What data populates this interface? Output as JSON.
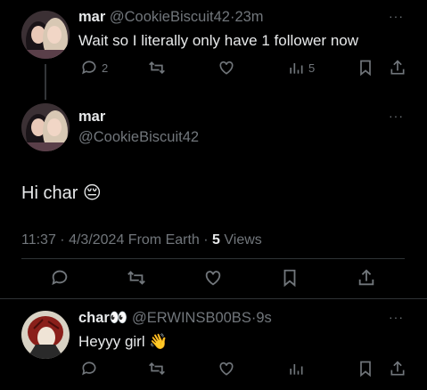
{
  "tweet1": {
    "name": "mar",
    "handle": "@CookieBiscuit42",
    "sep": "·",
    "time": "23m",
    "text": "Wait so I literally only have 1 follower now",
    "replies": "2",
    "views": "5"
  },
  "main": {
    "name": "mar",
    "handle": "@CookieBiscuit42",
    "text": "Hi char",
    "emoji": "😔",
    "meta_time": "11:37 · 4/3/2024 From Earth · ",
    "views_count": "5",
    "views_label": " Views"
  },
  "reply": {
    "name": "char",
    "name_emoji": "👀",
    "handle": "@ERWINSB00BS",
    "sep": "·",
    "time": "9s",
    "text": "Heyyy girl",
    "emoji": "👋"
  },
  "more_label": "···",
  "colors": {
    "background": "#000000",
    "text": "#e7e9ea",
    "muted": "#71767b",
    "divider": "#2f3336"
  }
}
